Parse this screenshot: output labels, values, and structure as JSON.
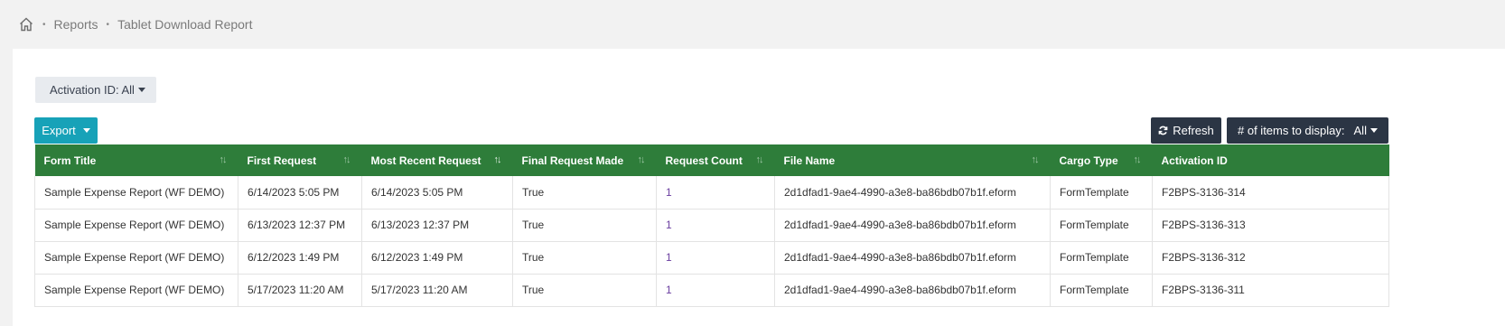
{
  "breadcrumb": {
    "home_icon": "home-icon",
    "items": [
      "Reports",
      "Tablet Download Report"
    ]
  },
  "filters": {
    "activation_id_label": "Activation ID: All"
  },
  "toolbar": {
    "export_label": "Export",
    "refresh_label": "Refresh",
    "refresh_icon": "refresh-icon",
    "items_label": "# of items to display:",
    "items_value": "All"
  },
  "colors": {
    "header_bg": "#2e7d3a",
    "export_bg": "#17a2b8",
    "dark_button_bg": "#2b3544"
  },
  "table": {
    "columns": [
      "Form Title",
      "First Request",
      "Most Recent Request",
      "Final Request Made",
      "Request Count",
      "File Name",
      "Cargo Type",
      "Activation ID"
    ],
    "sorted_column": "Most Recent Request",
    "rows": [
      [
        "Sample Expense Report (WF DEMO)",
        "6/14/2023 5:05 PM",
        "6/14/2023 5:05 PM",
        "True",
        "1",
        "2d1dfad1-9ae4-4990-a3e8-ba86bdb07b1f.eform",
        "FormTemplate",
        "F2BPS-3136-314"
      ],
      [
        "Sample Expense Report (WF DEMO)",
        "6/13/2023 12:37 PM",
        "6/13/2023 12:37 PM",
        "True",
        "1",
        "2d1dfad1-9ae4-4990-a3e8-ba86bdb07b1f.eform",
        "FormTemplate",
        "F2BPS-3136-313"
      ],
      [
        "Sample Expense Report (WF DEMO)",
        "6/12/2023 1:49 PM",
        "6/12/2023 1:49 PM",
        "True",
        "1",
        "2d1dfad1-9ae4-4990-a3e8-ba86bdb07b1f.eform",
        "FormTemplate",
        "F2BPS-3136-312"
      ],
      [
        "Sample Expense Report (WF DEMO)",
        "5/17/2023 11:20 AM",
        "5/17/2023 11:20 AM",
        "True",
        "1",
        "2d1dfad1-9ae4-4990-a3e8-ba86bdb07b1f.eform",
        "FormTemplate",
        "F2BPS-3136-311"
      ]
    ]
  }
}
